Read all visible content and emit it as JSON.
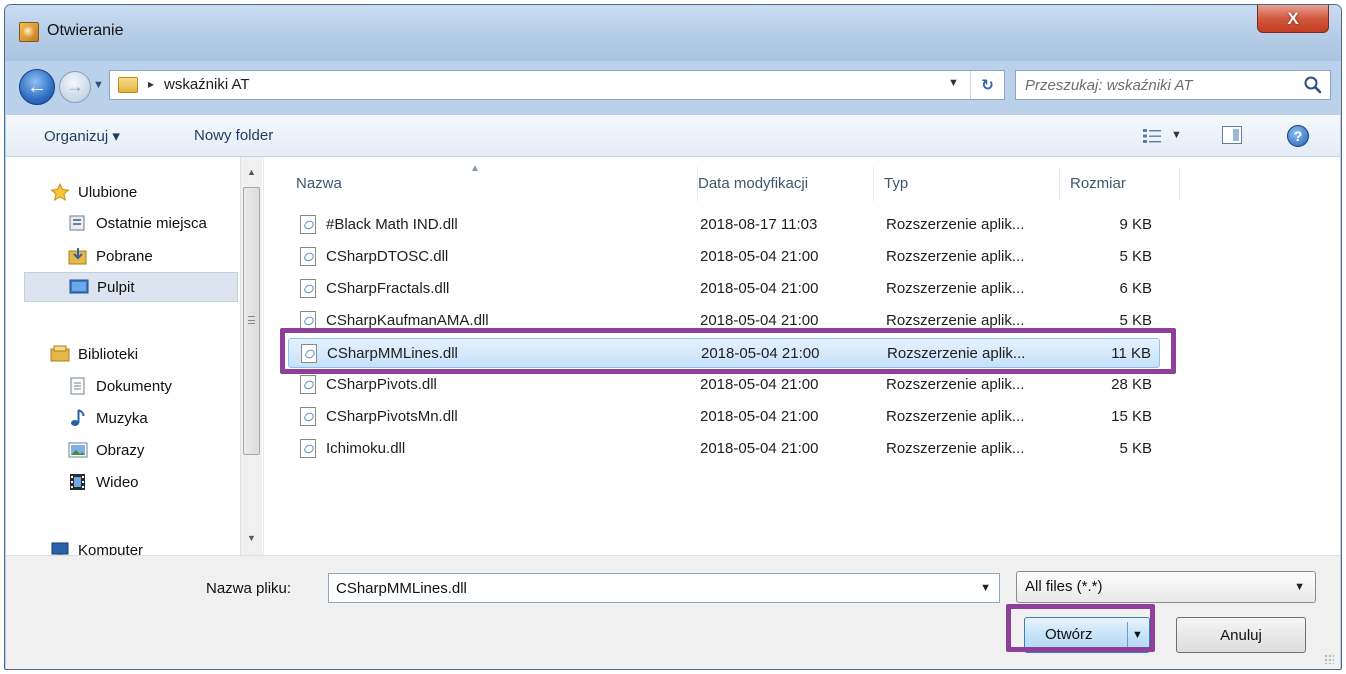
{
  "window": {
    "title": "Otwieranie",
    "close_label": "X"
  },
  "navigation": {
    "path_separator": "▸",
    "current_folder": "wskaźniki AT",
    "search_placeholder": "Przeszukaj: wskaźniki AT"
  },
  "toolbar": {
    "organize_label": "Organizuj ▾",
    "new_folder_label": "Nowy folder",
    "help_label": "?"
  },
  "sidebar": {
    "items": [
      {
        "label": "Ulubione",
        "icon": "star-icon"
      },
      {
        "label": "Ostatnie miejsca",
        "icon": "recent-places-icon"
      },
      {
        "label": "Pobrane",
        "icon": "downloads-icon"
      },
      {
        "label": "Pulpit",
        "icon": "desktop-icon"
      },
      {
        "label": "Biblioteki",
        "icon": "libraries-icon"
      },
      {
        "label": "Dokumenty",
        "icon": "documents-icon"
      },
      {
        "label": "Muzyka",
        "icon": "music-icon"
      },
      {
        "label": "Obrazy",
        "icon": "pictures-icon"
      },
      {
        "label": "Wideo",
        "icon": "video-icon"
      },
      {
        "label": "Komputer",
        "icon": "computer-icon"
      }
    ],
    "selected": "Pulpit"
  },
  "columns": {
    "name": "Nazwa",
    "date": "Data modyfikacji",
    "type": "Typ",
    "size": "Rozmiar"
  },
  "files": [
    {
      "name": "#Black Math IND.dll",
      "date": "2018-08-17 11:03",
      "type": "Rozszerzenie aplik...",
      "size": "9 KB"
    },
    {
      "name": "CSharpDTOSC.dll",
      "date": "2018-05-04 21:00",
      "type": "Rozszerzenie aplik...",
      "size": "5 KB"
    },
    {
      "name": "CSharpFractals.dll",
      "date": "2018-05-04 21:00",
      "type": "Rozszerzenie aplik...",
      "size": "6 KB"
    },
    {
      "name": "CSharpKaufmanAMA.dll",
      "date": "2018-05-04 21:00",
      "type": "Rozszerzenie aplik...",
      "size": "5 KB"
    },
    {
      "name": "CSharpMMLines.dll",
      "date": "2018-05-04 21:00",
      "type": "Rozszerzenie aplik...",
      "size": "11 KB"
    },
    {
      "name": "CSharpPivots.dll",
      "date": "2018-05-04 21:00",
      "type": "Rozszerzenie aplik...",
      "size": "28 KB"
    },
    {
      "name": "CSharpPivotsMn.dll",
      "date": "2018-05-04 21:00",
      "type": "Rozszerzenie aplik...",
      "size": "15 KB"
    },
    {
      "name": "Ichimoku.dll",
      "date": "2018-05-04 21:00",
      "type": "Rozszerzenie aplik...",
      "size": "5 KB"
    }
  ],
  "selected_file": "CSharpMMLines.dll",
  "bottom": {
    "file_name_label": "Nazwa pliku:",
    "file_name_value": "CSharpMMLines.dll",
    "filter_value": "All files (*.*)",
    "open_label": "Otwórz",
    "cancel_label": "Anuluj"
  },
  "colors": {
    "highlight": "#8e3f98",
    "selection": "#c6e2fa",
    "window_frame": "#b9d1ea"
  }
}
